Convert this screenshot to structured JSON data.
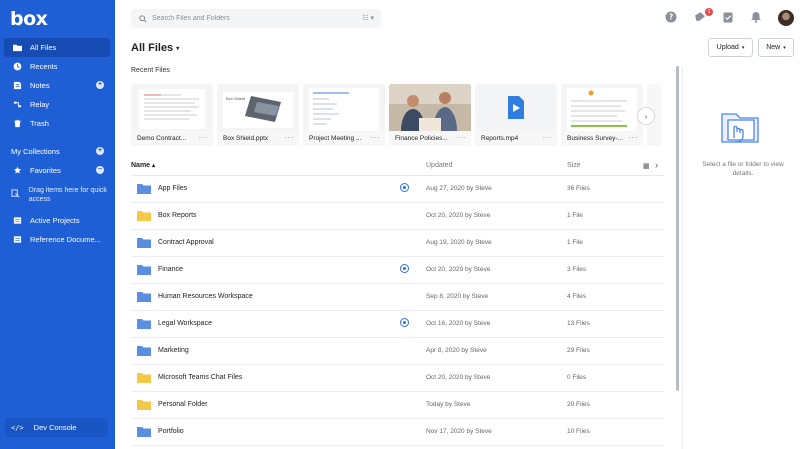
{
  "app": {
    "logo": "box"
  },
  "sidebar": {
    "items": [
      {
        "label": "All Files",
        "icon": "folder-icon",
        "active": true
      },
      {
        "label": "Recents",
        "icon": "clock-icon"
      },
      {
        "label": "Notes",
        "icon": "notes-icon",
        "has_add": true
      },
      {
        "label": "Relay",
        "icon": "relay-icon"
      },
      {
        "label": "Trash",
        "icon": "trash-icon"
      }
    ],
    "my_collections": {
      "label": "My Collections",
      "add": "+"
    },
    "favorites": {
      "label": "Favorites",
      "toggle": "−"
    },
    "drag_hint": "Drag items here for quick access",
    "collections": [
      {
        "label": "Active Projects",
        "icon": "collection-icon"
      },
      {
        "label": "Reference Docume...",
        "icon": "collection-icon"
      }
    ],
    "dev_console": {
      "label": "Dev Console",
      "icon": "code-icon"
    }
  },
  "header": {
    "search_placeholder": "Search Files and Folders",
    "notification_badge": "1"
  },
  "page": {
    "title": "All Files",
    "upload_label": "Upload",
    "new_label": "New"
  },
  "recent": {
    "label": "Recent Files",
    "files": [
      {
        "name": "Demo Contract..."
      },
      {
        "name": "Box Shield.pptx"
      },
      {
        "name": "Project Meeting ..."
      },
      {
        "name": "Finance Policies..."
      },
      {
        "name": "Reports.mp4"
      },
      {
        "name": "Business Survey-..."
      }
    ]
  },
  "table": {
    "columns": {
      "name": "Name",
      "updated": "Updated",
      "size": "Size"
    },
    "rows": [
      {
        "name": "App Files",
        "updated": "Aug 27, 2020 by Steve",
        "size": "36 Files",
        "collab": true,
        "color": "#5b8ee0"
      },
      {
        "name": "Box Reports",
        "updated": "Oct 20, 2020 by Steve",
        "size": "1 File",
        "collab": false,
        "color": "#f3c94a"
      },
      {
        "name": "Contract Approval",
        "updated": "Aug 19, 2020 by Steve",
        "size": "1 File",
        "collab": false,
        "color": "#5b8ee0"
      },
      {
        "name": "Finance",
        "updated": "Oct 20, 2020 by Steve",
        "size": "3 Files",
        "collab": true,
        "color": "#5b8ee0"
      },
      {
        "name": "Human Resources Workspace",
        "updated": "Sep 8, 2020 by Steve",
        "size": "4 Files",
        "collab": false,
        "color": "#5b8ee0"
      },
      {
        "name": "Legal Workspace",
        "updated": "Oct 16, 2020 by Steve",
        "size": "13 Files",
        "collab": true,
        "color": "#5b8ee0"
      },
      {
        "name": "Marketing",
        "updated": "Apr 8, 2020 by Steve",
        "size": "29 Files",
        "collab": false,
        "color": "#5b8ee0"
      },
      {
        "name": "Microsoft Teams Chat Files",
        "updated": "Oct 20, 2020 by Steve",
        "size": "0 Files",
        "collab": false,
        "color": "#f3c94a"
      },
      {
        "name": "Personal Folder",
        "updated": "Today by Steve",
        "size": "20 Files",
        "collab": false,
        "color": "#f3c94a"
      },
      {
        "name": "Portfolio",
        "updated": "Nov 17, 2020 by Steve",
        "size": "10 Files",
        "collab": false,
        "color": "#5b8ee0"
      }
    ]
  },
  "details": {
    "empty_text": "Select a file or folder to view details."
  }
}
